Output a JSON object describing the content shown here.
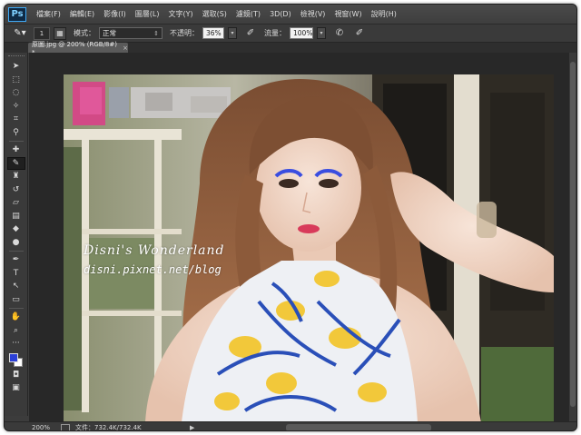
{
  "app": {
    "logo": "Ps"
  },
  "menus": [
    "檔案(F)",
    "編輯(E)",
    "影像(I)",
    "圖層(L)",
    "文字(Y)",
    "選取(S)",
    "濾鏡(T)",
    "3D(D)",
    "檢視(V)",
    "視窗(W)",
    "說明(H)"
  ],
  "options": {
    "brush_size": "1",
    "mode_label": "模式：",
    "mode_value": "正常",
    "opacity_label": "不透明：",
    "opacity_value": "36%",
    "flow_label": "流量：",
    "flow_value": "100%"
  },
  "document": {
    "tab_title": "原圖.jpg @ 200% (RGB/8#) *",
    "close": "×"
  },
  "colors": {
    "foreground": "#2b3fd6",
    "background": "#ffffff",
    "accent": "#3fa9f5"
  },
  "watermark": {
    "line1": "Disni's Wonderland",
    "line2": "disni.pixnet.net/blog"
  },
  "status": {
    "zoom": "200%",
    "doc_info": "文件：732.4K/732.4K",
    "arrow": "▶"
  }
}
